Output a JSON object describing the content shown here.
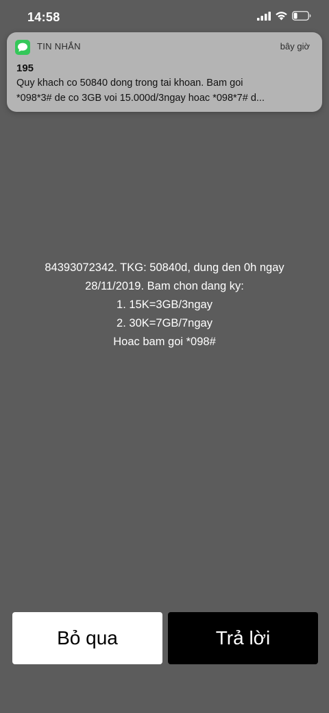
{
  "status_bar": {
    "time": "14:58",
    "icons": [
      "signal-icon",
      "wifi-icon",
      "battery-icon"
    ]
  },
  "notification": {
    "app_icon": "messages-icon",
    "app_name": "TIN NHẮN",
    "time": "bây giờ",
    "sender": "195",
    "body_lines": [
      "Quy khach co 50840 dong trong tai khoan. Bam goi",
      "*098*3# de co 3GB voi 15.000d/3ngay hoac *098*7# d..."
    ]
  },
  "ussd": {
    "lines": [
      "84393072342. TKG: 50840d, dung den 0h ngay",
      "28/11/2019. Bam chon dang ky:",
      "1. 15K=3GB/3ngay",
      "2. 30K=7GB/7ngay",
      "Hoac bam goi *098#"
    ]
  },
  "buttons": {
    "skip_label": "Bỏ qua",
    "reply_label": "Trả lời"
  },
  "colors": {
    "background": "#5c5c5c",
    "notification_bg": "#b4b4b4",
    "messages_green": "#34c759",
    "skip_button": "#ffffff",
    "reply_button": "#000000"
  }
}
